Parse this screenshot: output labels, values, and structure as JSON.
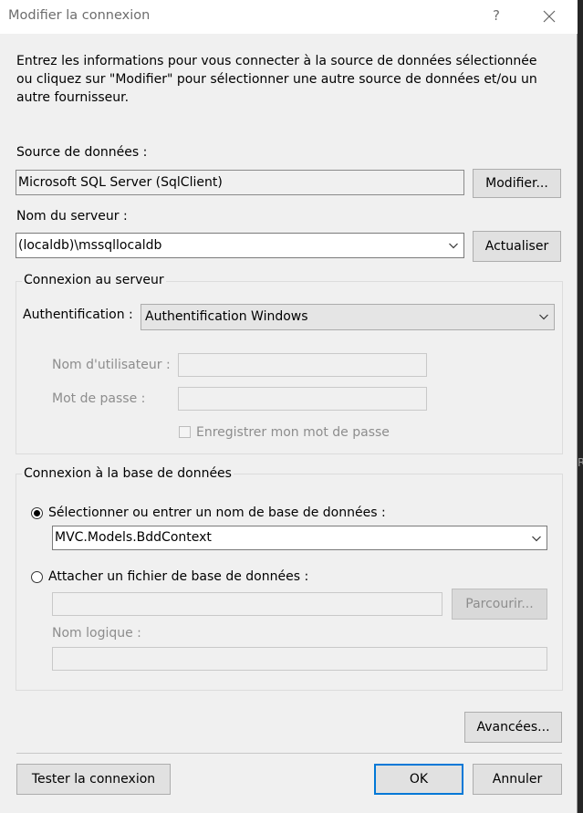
{
  "window": {
    "title": "Modifier la connexion",
    "help": "?"
  },
  "intro_text": "Entrez les informations pour vous connecter à la source de données sélectionnée ou cliquez sur \"Modifier\" pour sélectionner une autre source de données et/ou un autre fournisseur.",
  "data_source": {
    "label": "Source de données :",
    "value": "Microsoft SQL Server (SqlClient)",
    "modify_button": "Modifier..."
  },
  "server": {
    "label": "Nom du serveur :",
    "value": "(localdb)\\mssqllocaldb",
    "refresh_button": "Actualiser"
  },
  "server_group": {
    "title": "Connexion au serveur",
    "auth_label": "Authentification :",
    "auth_value": "Authentification Windows",
    "username_label": "Nom d'utilisateur :",
    "username_value": "",
    "password_label": "Mot de passe :",
    "password_value": "",
    "save_password_label": "Enregistrer mon mot de passe",
    "save_password_checked": false
  },
  "database_group": {
    "title": "Connexion à la base de données",
    "select_db_label": "Sélectionner ou entrer un nom de base de données :",
    "select_db_selected": true,
    "db_value": "MVC.Models.BddContext",
    "attach_label": "Attacher un fichier de base de données :",
    "attach_selected": false,
    "attach_value": "",
    "browse_button": "Parcourir...",
    "logical_name_label": "Nom logique :",
    "logical_name_value": ""
  },
  "advanced_button": "Avancées...",
  "footer": {
    "test_button": "Tester la connexion",
    "ok_button": "OK",
    "cancel_button": "Annuler"
  },
  "background_edge_text": "R"
}
